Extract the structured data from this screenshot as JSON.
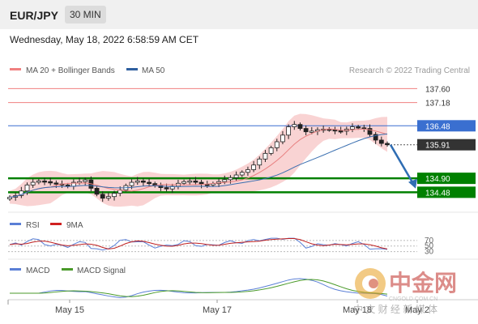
{
  "header": {
    "symbol": "EUR/JPY",
    "interval": "30 MIN"
  },
  "timestamp": "Wednesday, May 18, 2022 6:58:59 AM CET",
  "colors": {
    "resistance": "#f08080",
    "support": "#008000",
    "pivot": "#3a6fd0",
    "last": "#333333",
    "arrow": "#2f6db3",
    "bands": "#f7c8c8",
    "ma50": "#3a6fb0",
    "ma20": "#e88080"
  },
  "legend": {
    "ma20": "MA 20 + Bollinger Bands",
    "ma50": "MA 50",
    "credit": "Research © 2022 Trading Central"
  },
  "levels": [
    {
      "value": "137.60",
      "type": "resistance"
    },
    {
      "value": "137.18",
      "type": "resistance"
    },
    {
      "value": "136.48",
      "type": "pivot"
    },
    {
      "value": "135.91",
      "type": "last"
    },
    {
      "value": "134.90",
      "type": "support"
    },
    {
      "value": "134.48",
      "type": "support"
    }
  ],
  "rsi": {
    "label": "RSI",
    "ma_label": "9MA",
    "levels": [
      "70",
      "50",
      "30"
    ]
  },
  "macd": {
    "label": "MACD",
    "signal_label": "MACD Signal"
  },
  "x_axis": [
    "May 15",
    "May 17",
    "May 18",
    "May 2"
  ],
  "watermark": {
    "title": "中金网",
    "url": "CNGOLD.COM.CN",
    "sub": "中 文 财 经 新 媒 体"
  },
  "chart_data": {
    "type": "candlestick",
    "x_ticks": [
      "May 15",
      "May 17",
      "May 18",
      "May 2"
    ],
    "price_levels": [
      137.6,
      137.18,
      136.48,
      135.91,
      134.9,
      134.48
    ],
    "last_price": 135.91,
    "indicators": [
      "MA 20 + Bollinger Bands",
      "MA 50",
      "RSI",
      "9MA",
      "MACD",
      "MACD Signal"
    ],
    "rsi_levels": [
      70,
      50,
      30
    ],
    "close_series": [
      134.33,
      134.38,
      134.52,
      134.7,
      134.78,
      134.82,
      134.8,
      134.76,
      134.73,
      134.7,
      134.66,
      134.78,
      134.8,
      134.85,
      134.6,
      134.42,
      134.3,
      134.35,
      134.45,
      134.55,
      134.68,
      134.78,
      134.82,
      134.78,
      134.74,
      134.68,
      134.62,
      134.58,
      134.66,
      134.75,
      134.8,
      134.82,
      134.78,
      134.72,
      134.7,
      134.74,
      134.8,
      134.86,
      134.92,
      135.0,
      135.08,
      135.16,
      135.3,
      135.48,
      135.65,
      135.82,
      136.0,
      136.2,
      136.45,
      136.52,
      136.4,
      136.3,
      136.32,
      136.36,
      136.38,
      136.36,
      136.33,
      136.32,
      136.38,
      136.45,
      136.42,
      136.4,
      136.22,
      136.05,
      135.95,
      135.91
    ]
  }
}
